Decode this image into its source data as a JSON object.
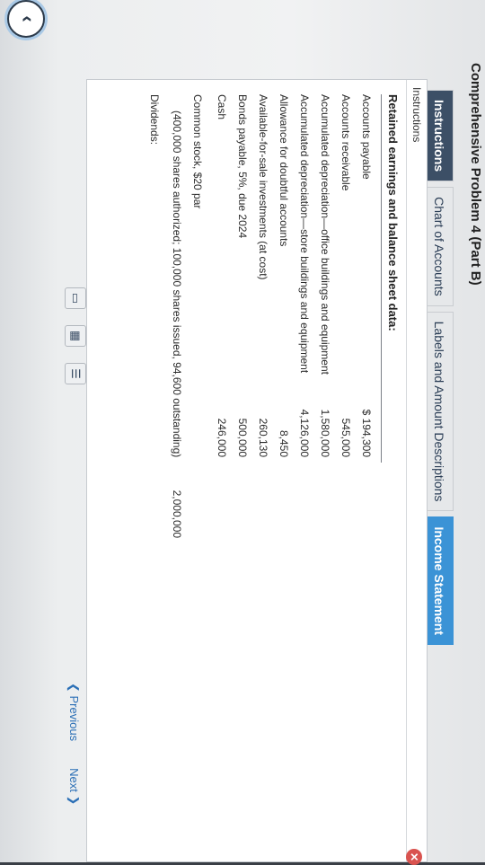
{
  "page": {
    "title": "Comprehensive Problem 4 (Part B)"
  },
  "tabs": [
    {
      "label": "Instructions"
    },
    {
      "label": "Chart of Accounts"
    },
    {
      "label": "Labels and Amount Descriptions"
    },
    {
      "label": "Income Statement"
    }
  ],
  "panel": {
    "header": "Instructions",
    "section_title": "Retained earnings and balance sheet data:",
    "items": [
      {
        "label": "Accounts payable",
        "amount": "$ 194,300"
      },
      {
        "label": "Accounts receivable",
        "amount": "545,000"
      },
      {
        "label": "Accumulated depreciation—office buildings and equipment",
        "amount": "1,580,000"
      },
      {
        "label": "Accumulated depreciation—store buildings and equipment",
        "amount": "4,126,000"
      },
      {
        "label": "Allowance for doubtful accounts",
        "amount": "8,450"
      },
      {
        "label": "Available-for-sale investments (at cost)",
        "amount": "260,130"
      },
      {
        "label": "Bonds payable, 5%, due 2024",
        "amount": "500,000"
      },
      {
        "label": "Cash",
        "amount": "246,000"
      },
      {
        "label": "Common stock, $20 par",
        "amount": ""
      },
      {
        "label": "(400,000 shares authorized; 100,000 shares issued, 94,600 outstanding)",
        "amount": "2,000,000"
      },
      {
        "label": "Dividends:",
        "amount": ""
      }
    ]
  },
  "nav": {
    "previous": "Previous",
    "next": "Next"
  },
  "icons": {
    "back": "chevron-left-icon",
    "close": "close-icon"
  }
}
